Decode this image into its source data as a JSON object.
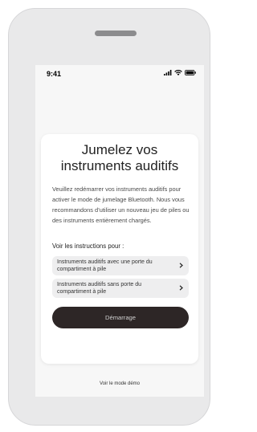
{
  "status": {
    "time": "9:41"
  },
  "card": {
    "title_line1": "Jumelez vos",
    "title_line2": "instruments auditifs",
    "body": "Veuillez redémarrer vos instruments auditifs pour activer le mode de jumelage Bluetooth. Nous vous recommandons d’utiliser un nouveau jeu de piles ou des instruments entièrement chargés.",
    "instructions_label": "Voir les instructions pour :",
    "options": [
      {
        "label": "Instruments auditifs avec une porte du compartiment à pile"
      },
      {
        "label": "Instruments auditifs sans porte du compartiment à pile"
      }
    ],
    "start_label": "Démarrage"
  },
  "footer": {
    "demo_link": "Voir le mode démo"
  },
  "colors": {
    "button_bg": "#2d2626",
    "screen_bg": "#f7f7f7",
    "device_bg": "#e9e9ea"
  }
}
